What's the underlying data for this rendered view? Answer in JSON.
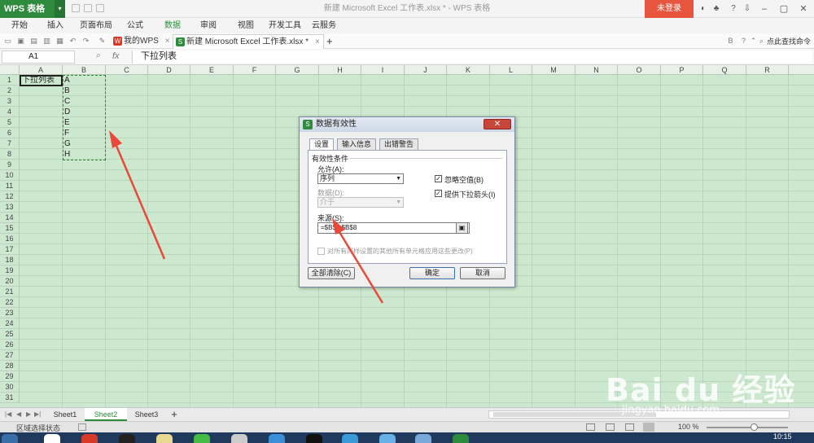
{
  "app": {
    "name": "WPS 表格",
    "doc_title": "新建 Microsoft Excel 工作表.xlsx * - WPS 表格",
    "login": "未登录"
  },
  "menu": [
    "开始",
    "插入",
    "页面布局",
    "公式",
    "数据",
    "审阅",
    "视图",
    "开发工具",
    "云服务"
  ],
  "tabs": [
    {
      "label": "我的WPS",
      "close": "×"
    },
    {
      "label": "新建 Microsoft Excel 工作表.xlsx *",
      "close": "×"
    }
  ],
  "tab_add": "+",
  "search_cmd": "点此查找命令",
  "formula_bar": {
    "cell_ref": "A1",
    "fx": "fx",
    "content": "下拉列表"
  },
  "columns": [
    "A",
    "B",
    "C",
    "D",
    "E",
    "F",
    "G",
    "H",
    "I",
    "J",
    "K",
    "L",
    "M",
    "N",
    "O",
    "P",
    "Q",
    "R"
  ],
  "rows": [
    "1",
    "2",
    "3",
    "4",
    "5",
    "6",
    "7",
    "8",
    "9",
    "10",
    "11",
    "12",
    "13",
    "14",
    "15",
    "16",
    "17",
    "18",
    "19",
    "20",
    "21",
    "22",
    "23",
    "24",
    "25",
    "26",
    "27",
    "28",
    "29",
    "30",
    "31"
  ],
  "cells": {
    "a1": "下拉列表",
    "b_list": [
      "A",
      "B",
      "C",
      "D",
      "E",
      "F",
      "G",
      "H"
    ]
  },
  "dialog": {
    "title": "数据有效性",
    "tabs": [
      "设置",
      "输入信息",
      "出错警告"
    ],
    "section": "有效性条件",
    "allow_label": "允许(A):",
    "allow_value": "序列",
    "data_label": "数据(D):",
    "data_value": "介于",
    "ignore_blank": "忽略空值(B)",
    "dropdown_arrow": "提供下拉箭头(I)",
    "source_label": "来源(S):",
    "source_value": "=$B$1:$B$8",
    "apply_all": "对所有同样设置的其他所有单元格应用这些更改(P)",
    "clear_all": "全部清除(C)",
    "ok": "确定",
    "cancel": "取消"
  },
  "sheets": [
    "Sheet1",
    "Sheet2",
    "Sheet3"
  ],
  "sheet_add": "+",
  "status": {
    "text": "区域选择状态",
    "zoom": "100 %"
  },
  "clock": "10:15",
  "watermark": {
    "brand": "Bai du 经验",
    "url": "jingyan.baidu.com"
  },
  "colors": {
    "accent": "#2e8b3e",
    "grid_bg": "#cce8cf",
    "login_bg": "#e8553e",
    "arrow": "#e8493a"
  }
}
